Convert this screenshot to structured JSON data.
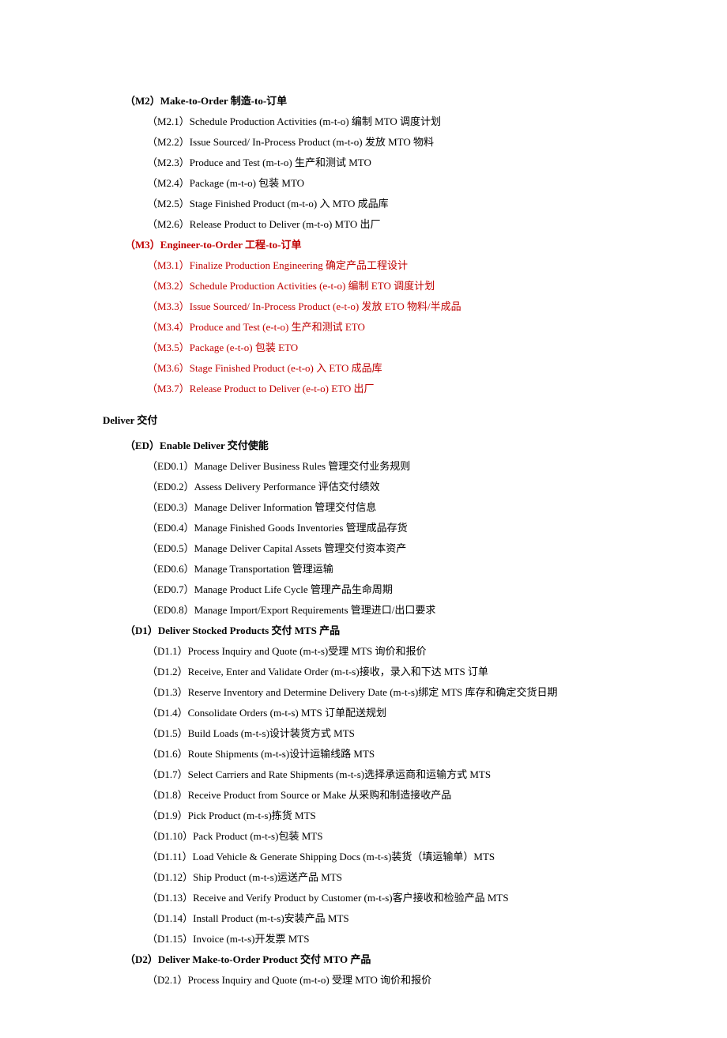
{
  "m2": {
    "header": "（M2）Make-to-Order 制造-to-订单",
    "items": [
      "（M2.1）Schedule Production Activities (m-t-o)  编制 MTO 调度计划",
      "（M2.2）Issue Sourced/ In-Process Product (m-t-o)  发放 MTO 物料",
      "（M2.3）Produce and Test (m-t-o)  生产和测试 MTO",
      "（M2.4）Package (m-t-o)  包装 MTO",
      "（M2.5）Stage Finished Product (m-t-o)  入 MTO 成品库",
      "（M2.6）Release Product to Deliver (m-t-o) MTO 出厂"
    ]
  },
  "m3": {
    "header": "（M3）Engineer-to-Order 工程-to-订单",
    "items": [
      "（M3.1）Finalize Production Engineering 确定产品工程设计",
      "（M3.2）Schedule Production Activities (e-t-o)  编制 ETO 调度计划",
      "（M3.3）Issue Sourced/ In-Process Product (e-t-o)  发放 ETO 物料/半成品",
      "（M3.4）Produce and Test (e-t-o)  生产和测试 ETO",
      "（M3.5）Package (e-t-o)  包装 ETO",
      "（M3.6）Stage Finished Product (e-t-o)  入 ETO 成品库",
      "（M3.7）Release Product to Deliver (e-t-o) ETO 出厂"
    ]
  },
  "deliver": {
    "title": "Deliver 交付"
  },
  "ed": {
    "header": "（ED）Enable Deliver 交付使能",
    "items": [
      "（ED0.1）Manage Deliver Business Rules 管理交付业务规则",
      "（ED0.2）Assess Delivery Performance 评估交付绩效",
      "（ED0.3）Manage Deliver Information 管理交付信息",
      "（ED0.4）Manage Finished Goods Inventories 管理成品存货",
      "（ED0.5）Manage Deliver Capital Assets 管理交付资本资产",
      "（ED0.6）Manage Transportation 管理运输",
      "（ED0.7）Manage Product Life Cycle 管理产品生命周期",
      "（ED0.8）Manage Import/Export Requirements 管理进口/出口要求"
    ]
  },
  "d1": {
    "header": "（D1）Deliver Stocked Products  交付 MTS 产品",
    "items": [
      "（D1.1）Process Inquiry and Quote (m-t-s)受理 MTS 询价和报价",
      "（D1.2）Receive, Enter and Validate Order (m-t-s)接收，录入和下达 MTS 订单",
      "（D1.3）Reserve Inventory and Determine Delivery Date (m-t-s)绑定 MTS 库存和确定交货日期",
      "（D1.4）Consolidate Orders (m-t-s) MTS 订单配送规划",
      "（D1.5）Build Loads (m-t-s)设计装货方式 MTS",
      "（D1.6）Route Shipments (m-t-s)设计运输线路 MTS",
      "（D1.7）Select Carriers and Rate Shipments (m-t-s)选择承运商和运输方式 MTS",
      "（D1.8）Receive Product from Source or Make 从采购和制造接收产品",
      "（D1.9）Pick Product (m-t-s)拣货 MTS",
      "（D1.10）Pack Product (m-t-s)包装 MTS",
      "（D1.11）Load Vehicle & Generate Shipping Docs (m-t-s)装货（填运输单）MTS",
      "（D1.12）Ship Product (m-t-s)运送产品 MTS",
      "（D1.13）Receive and Verify Product by Customer (m-t-s)客户接收和检验产品 MTS",
      "（D1.14）Install Product (m-t-s)安装产品 MTS",
      "（D1.15）Invoice (m-t-s)开发票 MTS"
    ]
  },
  "d2": {
    "header": "（D2）Deliver Make-to-Order Product  交付 MTO 产品",
    "items": [
      "（D2.1）Process Inquiry and Quote (m-t-o)  受理 MTO 询价和报价"
    ]
  }
}
